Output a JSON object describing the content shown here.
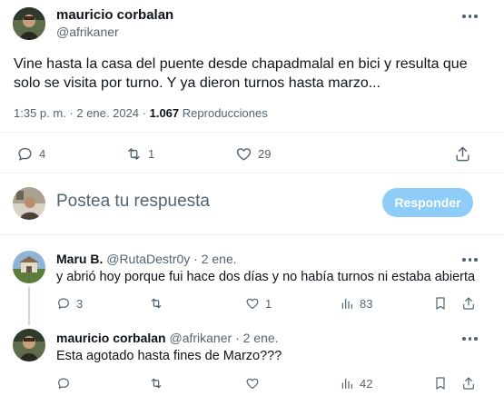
{
  "main_tweet": {
    "author_name": "mauricio corbalan",
    "handle": "@afrikaner",
    "text_line1": "Vine hasta la casa del puente desde chapadmalal en bici y resulta que",
    "text_line2": "solo se visita por turno. Y ya dieron turnos hasta marzo...",
    "time": "1:35 p. m. · 2 ene. 2024 ·",
    "views_count": "1.067",
    "views_label": "Reproducciones",
    "reply_count": "4",
    "retweet_count": "1",
    "like_count": "29"
  },
  "compose": {
    "placeholder": "Postea tu respuesta",
    "button_label": "Responder"
  },
  "replies": [
    {
      "author_name": "Maru B.",
      "handle": "@RutaDestr0y",
      "date": "· 2 ene.",
      "text": "y abrió hoy porque fui hace dos días y no había turnos ni estaba abierta",
      "reply_count": "3",
      "retweet_count": "",
      "like_count": "1",
      "views_count": "83"
    },
    {
      "author_name": "mauricio corbalan",
      "handle": "@afrikaner",
      "date": "· 2 ene.",
      "text": "Esta agotado hasta fines de Marzo???",
      "reply_count": "",
      "retweet_count": "",
      "like_count": "",
      "views_count": "42"
    }
  ],
  "colors": {
    "accent": "#1d9bf0",
    "button_disabled": "#8ecdf8",
    "muted_text": "#536471",
    "divider": "#eff3f4"
  }
}
